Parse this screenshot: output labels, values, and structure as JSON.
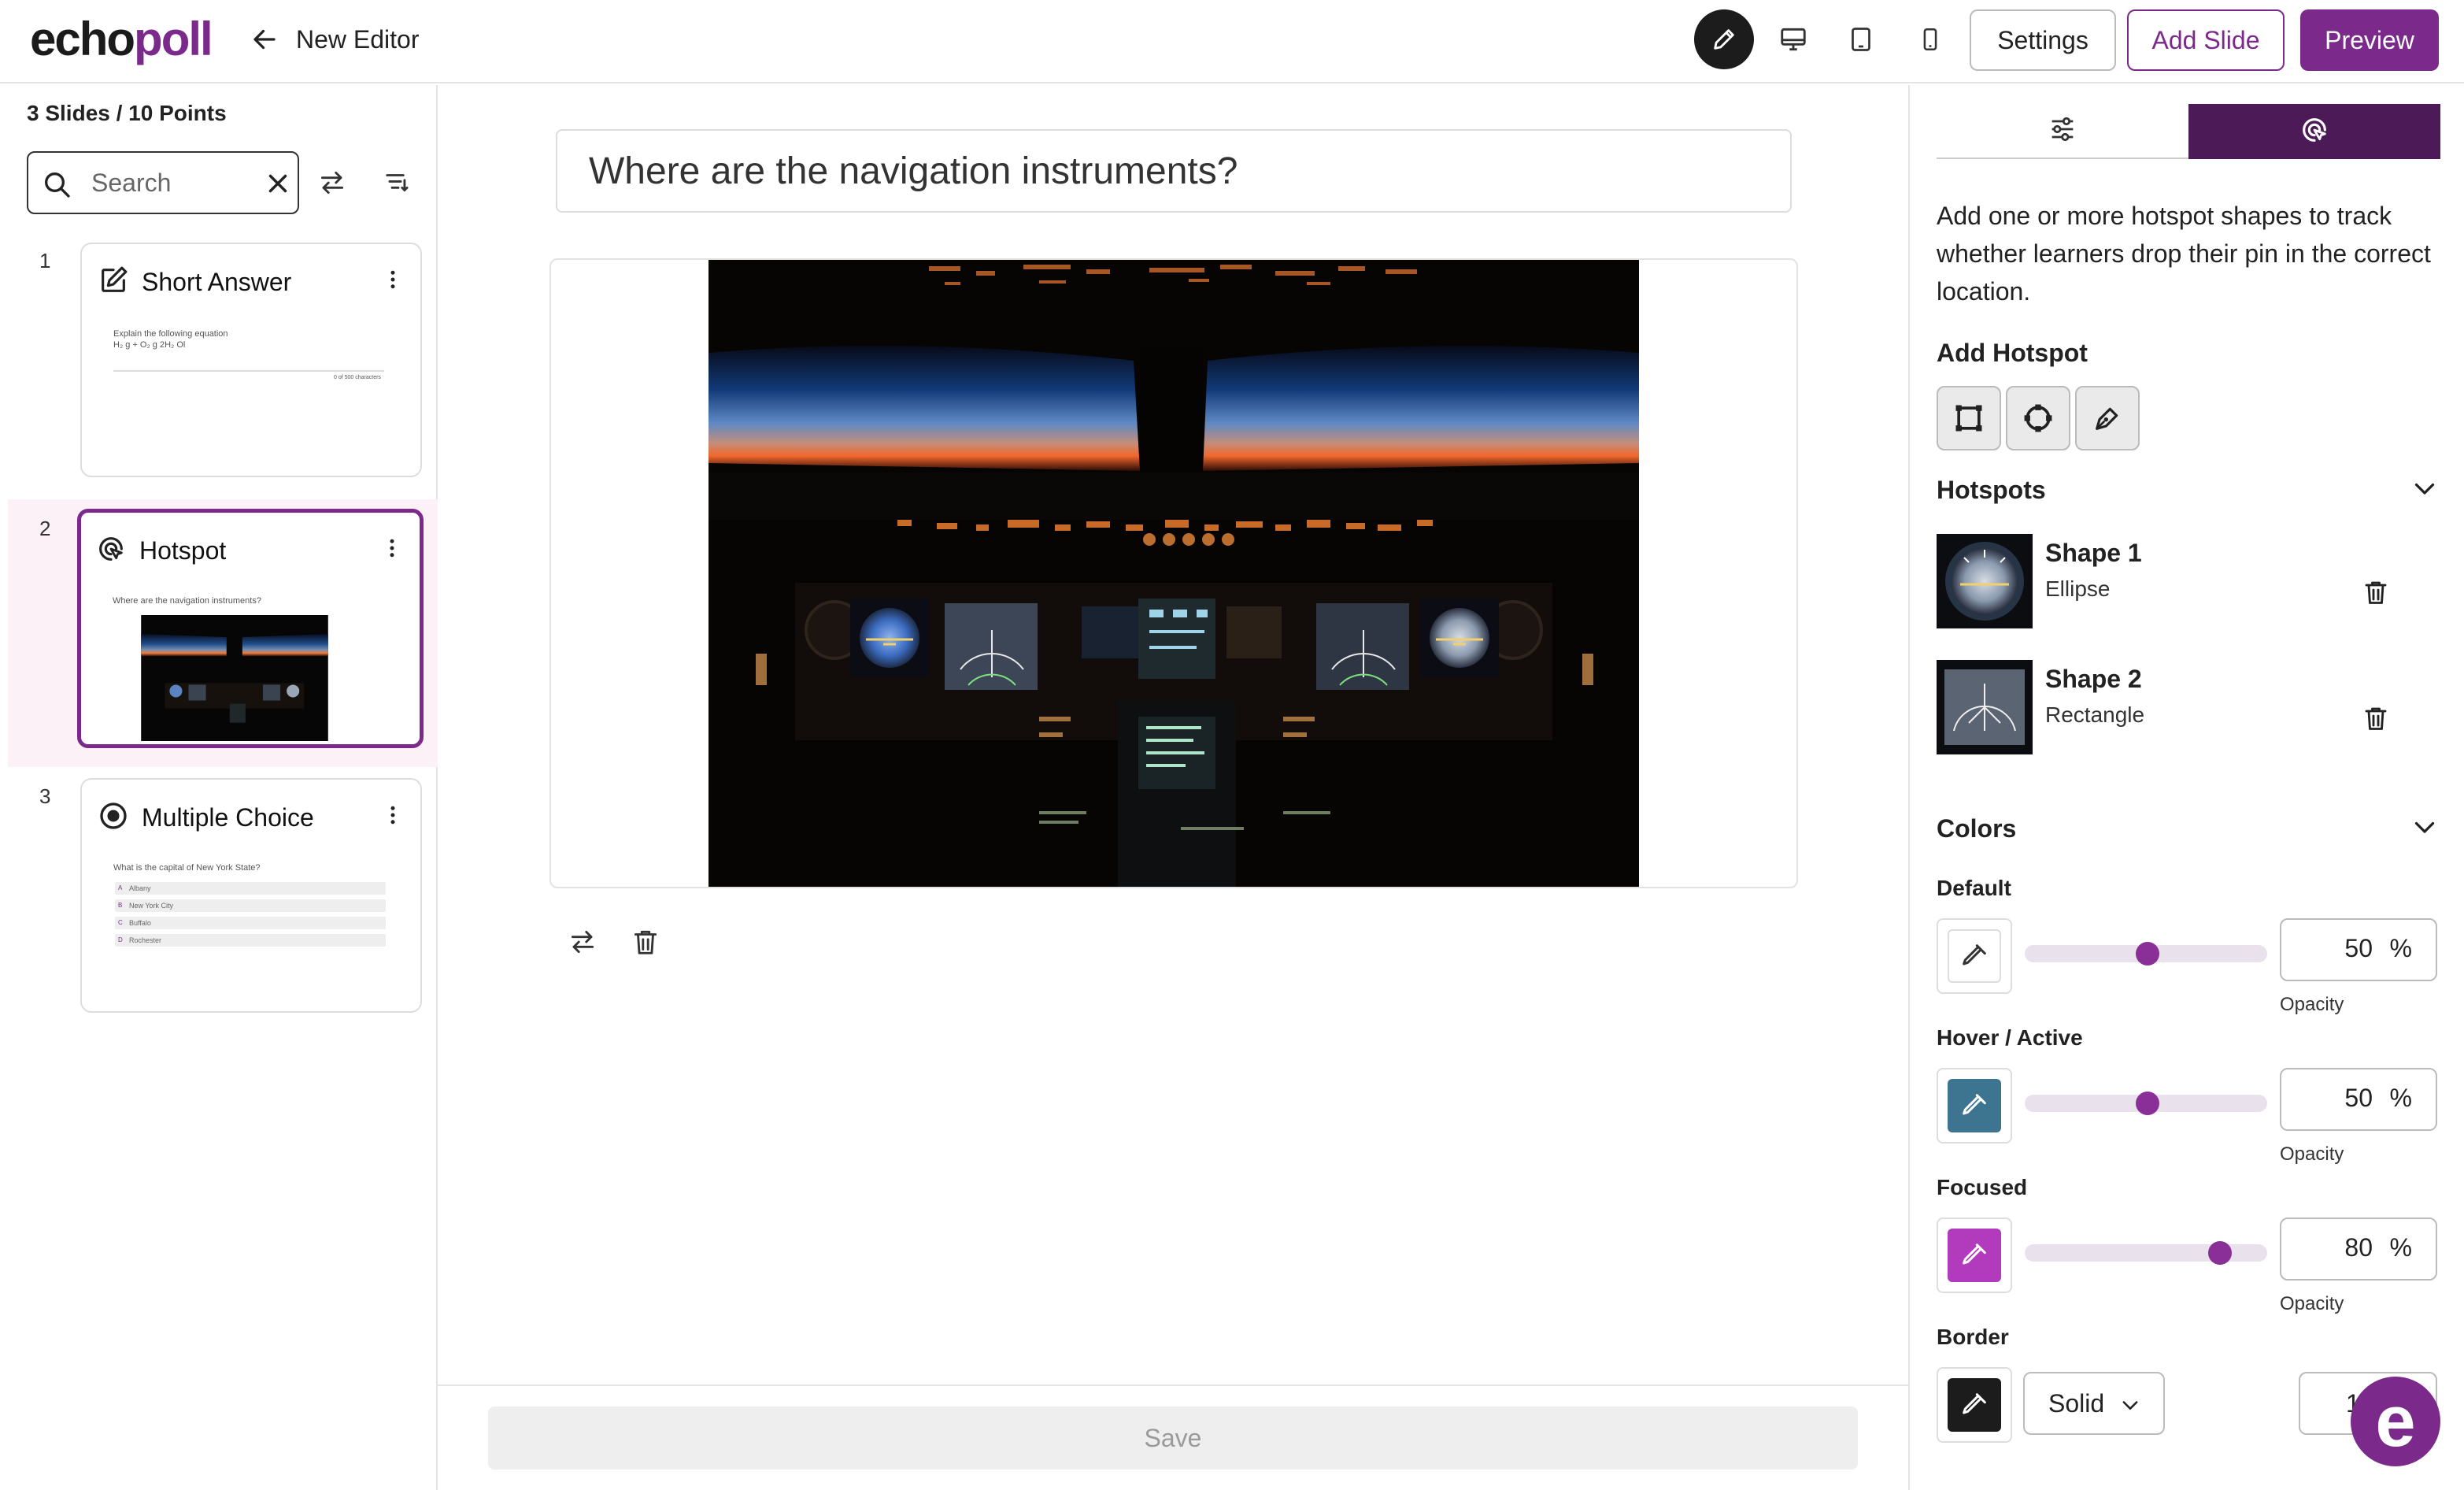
{
  "header": {
    "logo_echo": "echo",
    "logo_poll": "poll",
    "back_label": "New Editor",
    "device_icons": [
      "pencil-icon",
      "desktop-icon",
      "tablet-icon",
      "mobile-icon"
    ],
    "settings_label": "Settings",
    "add_slide_label": "Add Slide",
    "preview_label": "Preview",
    "brand_color": "#7b2a8b"
  },
  "sidebar": {
    "summary": "3 Slides / 10 Points",
    "search_placeholder": "Search",
    "slides": [
      {
        "number": "1",
        "title": "Short Answer",
        "icon": "edit-icon",
        "thumb_question": "Explain the following equation",
        "thumb_formula": "H₂ g + O₂ g    2H₂ Ol",
        "thumb_count": "0 of 500 characters"
      },
      {
        "number": "2",
        "title": "Hotspot",
        "icon": "hotspot-icon",
        "thumb_question": "Where are the navigation instruments?",
        "selected": true
      },
      {
        "number": "3",
        "title": "Multiple Choice",
        "icon": "radio-icon",
        "thumb_question": "What is the capital of New York State?",
        "options": [
          {
            "letter": "A",
            "text": "Albany"
          },
          {
            "letter": "B",
            "text": "New York City"
          },
          {
            "letter": "C",
            "text": "Buffalo"
          },
          {
            "letter": "D",
            "text": "Rochester"
          }
        ]
      }
    ]
  },
  "main": {
    "question": "Where are the navigation instruments?",
    "save_label": "Save"
  },
  "right_panel": {
    "tabs": [
      "settings-sliders-icon",
      "hotspot-icon"
    ],
    "description": "Add one or more hotspot shapes to track whether learners drop their pin in the correct location.",
    "add_hotspot_label": "Add Hotspot",
    "hotspot_tools": [
      "rectangle-tool-icon",
      "ellipse-tool-icon",
      "pen-tool-icon"
    ],
    "hotspots_label": "Hotspots",
    "shapes": [
      {
        "name": "Shape 1",
        "type": "Ellipse"
      },
      {
        "name": "Shape 2",
        "type": "Rectangle"
      }
    ],
    "colors_label": "Colors",
    "colors": [
      {
        "label": "Default",
        "swatch": "#ffffff",
        "opacity": "50",
        "level": 0.5
      },
      {
        "label": "Hover / Active",
        "swatch": "#3d7590",
        "opacity": "50",
        "level": 0.5
      },
      {
        "label": "Focused",
        "swatch": "#b23bbd",
        "opacity": "80",
        "level": 0.8
      }
    ],
    "percent_sign": "%",
    "opacity_caption": "Opacity",
    "border_label": "Border",
    "border_swatch": "#1c1c1c",
    "border_style": "Solid",
    "border_width": "1"
  },
  "fab": {
    "label": "e"
  }
}
